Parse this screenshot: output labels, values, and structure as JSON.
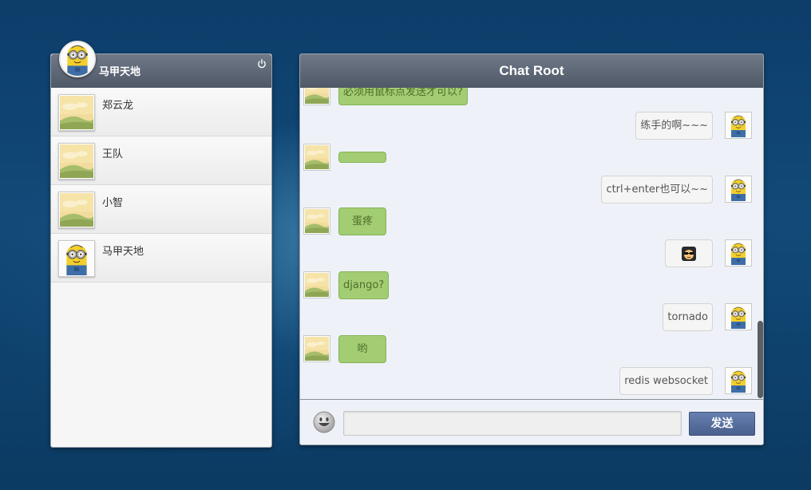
{
  "current_user": {
    "name": "马甲天地",
    "avatar": "minion-avatar"
  },
  "icons": {
    "power": "power-icon",
    "emoji": "smiley-icon"
  },
  "contacts": [
    {
      "name": "郑云龙",
      "avatar": "landscape-placeholder-avatar"
    },
    {
      "name": "王队",
      "avatar": "landscape-placeholder-avatar"
    },
    {
      "name": "小智",
      "avatar": "landscape-placeholder-avatar"
    },
    {
      "name": "马甲天地",
      "avatar": "minion-avatar"
    }
  ],
  "chat": {
    "title": "Chat Root",
    "messages": [
      {
        "side": "left",
        "text": "必须用鼠标点发送才可以?"
      },
      {
        "side": "right",
        "text": "练手的啊~~~"
      },
      {
        "side": "left",
        "text": ""
      },
      {
        "side": "right",
        "text": "ctrl+enter也可以~~"
      },
      {
        "side": "left",
        "text": "蛋疼"
      },
      {
        "side": "right",
        "text": "",
        "emoji": "glasses-face-emoji"
      },
      {
        "side": "left",
        "text": "django?"
      },
      {
        "side": "right",
        "text": "tornado"
      },
      {
        "side": "left",
        "text": "哟"
      },
      {
        "side": "right",
        "text": "redis websocket"
      }
    ],
    "input": {
      "value": "",
      "placeholder": ""
    },
    "send_label": "发送"
  },
  "colors": {
    "header": "#5d6674",
    "left_bubble": "#a3cd72",
    "right_bubble": "#f5f5f5",
    "send_button": "#546a98",
    "background": "#0f4572"
  }
}
